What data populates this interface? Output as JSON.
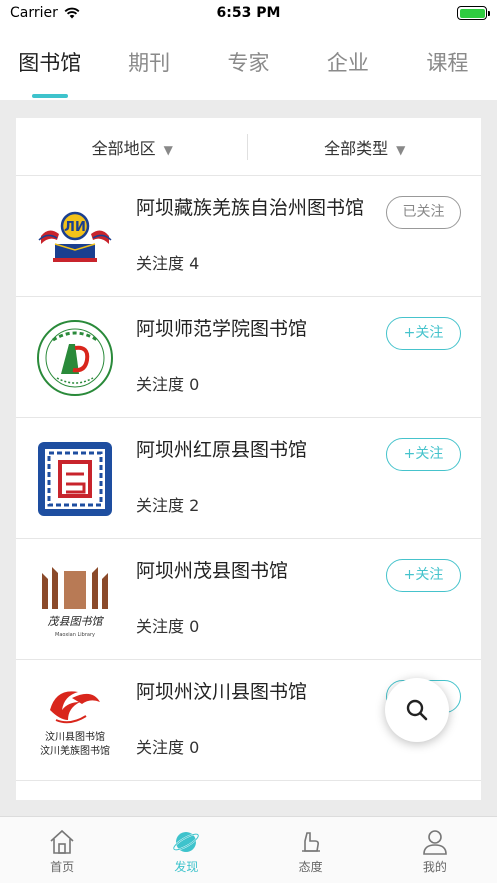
{
  "status": {
    "carrier": "Carrier",
    "time": "6:53 PM"
  },
  "tabs": [
    {
      "label": "图书馆",
      "active": true
    },
    {
      "label": "期刊"
    },
    {
      "label": "专家"
    },
    {
      "label": "企业"
    },
    {
      "label": "课程"
    }
  ],
  "filters": {
    "region": "全部地区",
    "type": "全部类型"
  },
  "libraries": [
    {
      "name": "阿坝藏族羌族自治州图书馆",
      "attention": "关注度 4",
      "button": "已关注",
      "followed": true
    },
    {
      "name": "阿坝师范学院图书馆",
      "attention": "关注度 0",
      "button": "+关注",
      "followed": false
    },
    {
      "name": "阿坝州红原县图书馆",
      "attention": "关注度 2",
      "button": "+关注",
      "followed": false
    },
    {
      "name": "阿坝州茂县图书馆",
      "attention": "关注度 0",
      "button": "+关注",
      "followed": false
    },
    {
      "name": "阿坝州汶川县图书馆",
      "attention": "关注度 0",
      "button": "+关注",
      "followed": false
    }
  ],
  "logo_text": {
    "maoxian_cn": "茂县图书馆",
    "maoxian_en": "Maoxian Library",
    "wenchuan_cn1": "汶川县图书馆",
    "wenchuan_cn2": "汶川羌族图书馆"
  },
  "nav": [
    {
      "label": "首页",
      "icon": "home-icon"
    },
    {
      "label": "发现",
      "icon": "planet-icon",
      "active": true
    },
    {
      "label": "态度",
      "icon": "attitude-icon"
    },
    {
      "label": "我的",
      "icon": "user-icon"
    }
  ],
  "colors": {
    "accent": "#3ec3cc",
    "followed": "#999999"
  }
}
